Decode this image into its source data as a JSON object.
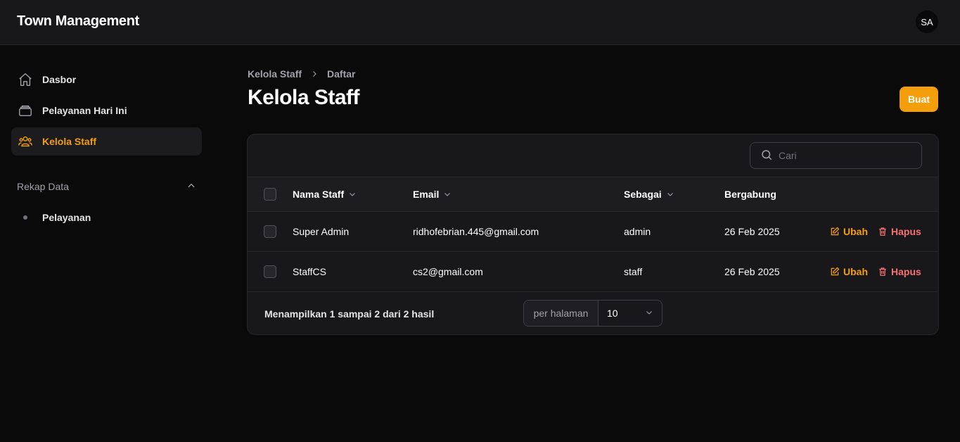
{
  "app": {
    "title": "Town Management",
    "user_initials": "SA"
  },
  "sidebar": {
    "items": [
      {
        "label": "Dasbor",
        "icon": "home-icon"
      },
      {
        "label": "Pelayanan Hari Ini",
        "icon": "inbox-icon"
      },
      {
        "label": "Kelola Staff",
        "icon": "users-icon",
        "active": true
      }
    ],
    "group": {
      "label": "Rekap Data",
      "expanded": true,
      "items": [
        {
          "label": "Pelayanan"
        }
      ]
    }
  },
  "breadcrumb": {
    "parent": "Kelola Staff",
    "current": "Daftar"
  },
  "page": {
    "title": "Kelola Staff",
    "create_label": "Buat"
  },
  "search": {
    "placeholder": "Cari"
  },
  "table": {
    "columns": {
      "name": "Nama Staff",
      "email": "Email",
      "role": "Sebagai",
      "joined": "Bergabung"
    },
    "rows": [
      {
        "name": "Super Admin",
        "email": "ridhofebrian.445@gmail.com",
        "role": "admin",
        "joined": "26 Feb 2025"
      },
      {
        "name": "StaffCS",
        "email": "cs2@gmail.com",
        "role": "staff",
        "joined": "26 Feb 2025"
      }
    ],
    "edit_label": "Ubah",
    "delete_label": "Hapus"
  },
  "pagination": {
    "summary": "Menampilkan 1 sampai 2 dari 2 hasil",
    "per_page_label": "per halaman",
    "per_page_value": "10"
  },
  "colors": {
    "accent": "#f59e0b",
    "danger": "#f87171",
    "background": "#0a0a0b",
    "surface": "#18181b"
  }
}
